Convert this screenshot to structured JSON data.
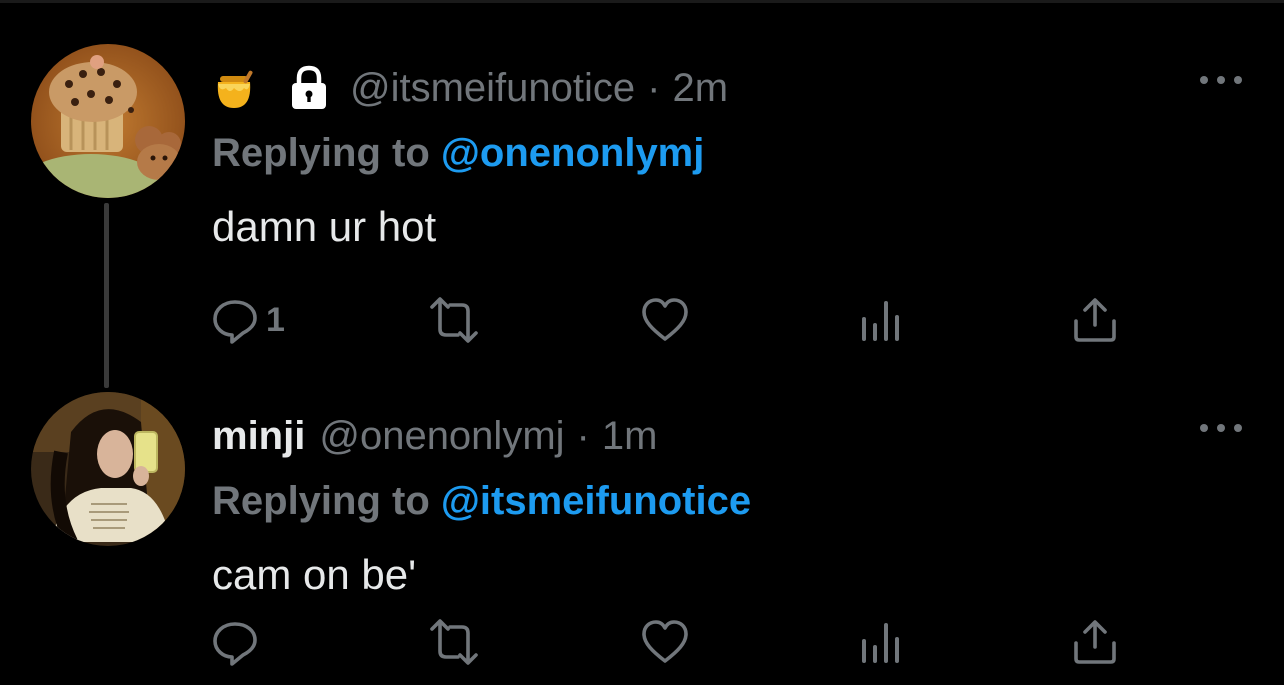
{
  "colors": {
    "background": "#000000",
    "primary_text": "#e7e9ea",
    "secondary_text": "#71767b",
    "accent": "#1d9bf0"
  },
  "tweets": [
    {
      "display_name": "",
      "name_icons": [
        "honey-pot-icon",
        "lock-icon"
      ],
      "handle": "@itsmeifunotice",
      "separator": "·",
      "time": "2m",
      "replying_prefix": "Replying to",
      "replying_to": "@onenonlymj",
      "text": "damn ur hot",
      "actions": {
        "reply_count": "1",
        "retweet_count": "",
        "like_count": "",
        "views_count": ""
      },
      "more_icon": "more-horizontal-icon"
    },
    {
      "display_name": "minji",
      "handle": "@onenonlymj",
      "separator": "·",
      "time": "1m",
      "replying_prefix": "Replying to",
      "replying_to": "@itsmeifunotice",
      "text": "cam on be'",
      "actions": {
        "reply_count": "",
        "retweet_count": "",
        "like_count": "",
        "views_count": ""
      },
      "more_icon": "more-horizontal-icon"
    }
  ]
}
